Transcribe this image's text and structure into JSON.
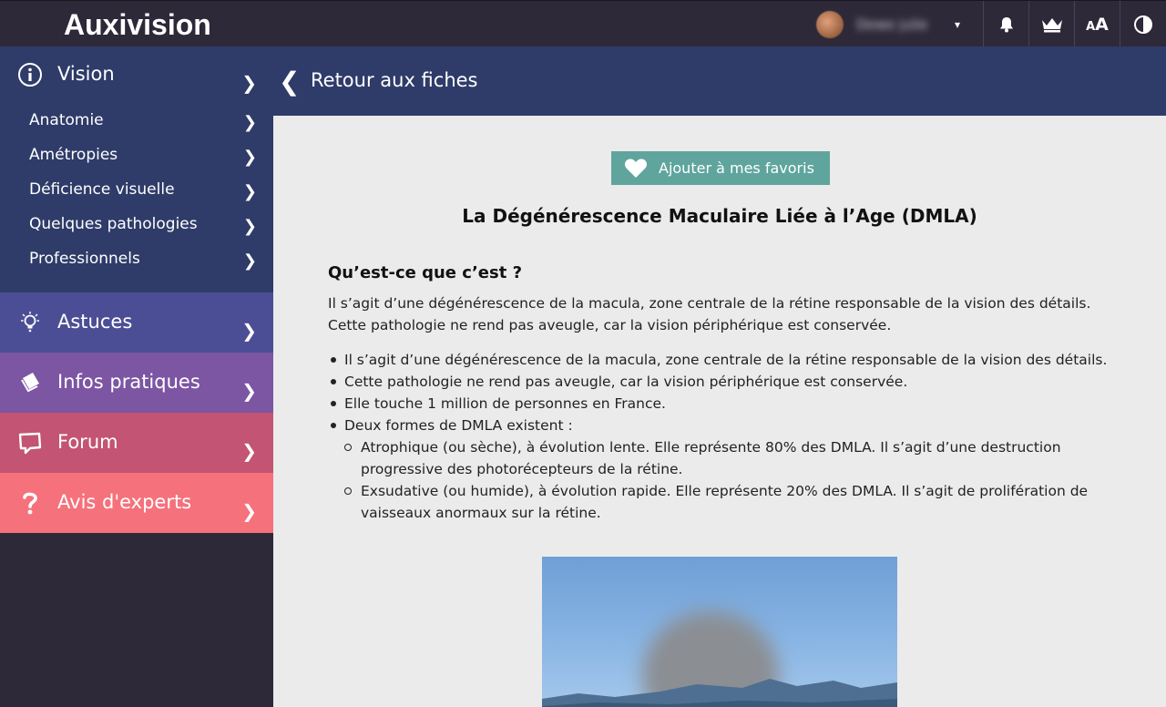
{
  "app": {
    "name": "Auxivision"
  },
  "header": {
    "user_name": "Dewe julie",
    "dropdown_caret": "▾",
    "icons": [
      "bell-icon",
      "crown-icon",
      "text-size-icon",
      "contrast-icon"
    ],
    "text_size_small": "A",
    "text_size_big": "A"
  },
  "sidebar": {
    "vision": {
      "label": "Vision",
      "icon": "info-icon",
      "items": [
        {
          "label": "Anatomie"
        },
        {
          "label": "Amétropies"
        },
        {
          "label": "Déficience visuelle"
        },
        {
          "label": "Quelques pathologies"
        },
        {
          "label": "Professionnels"
        }
      ]
    },
    "sections": [
      {
        "label": "Astuces",
        "icon": "lightbulb-icon",
        "color": "#4c4e95"
      },
      {
        "label": "Infos pratiques",
        "icon": "book-icon",
        "color": "#7c55a3"
      },
      {
        "label": "Forum",
        "icon": "chat-icon",
        "color": "#c35473"
      },
      {
        "label": "Avis d'experts",
        "icon": "question-icon",
        "color": "#f5717b"
      }
    ],
    "chevron": "❯"
  },
  "backbar": {
    "chevron": "❮",
    "label": "Retour aux fiches"
  },
  "content": {
    "favorite_label": "Ajouter à mes favoris",
    "title": "La Dégénérescence Maculaire Liée à l’Age (DMLA)",
    "subtitle": "Qu’est-ce que c’est ?",
    "intro": [
      "Il s’agit d’une dégénérescence de la macula, zone centrale de la rétine responsable de la vision des détails.",
      "Cette pathologie ne rend pas aveugle, car la vision périphérique est conservée."
    ],
    "bullets": [
      "Il s’agit d’une dégénérescence de la macula, zone centrale de la rétine responsable de la vision des détails.",
      "Cette pathologie ne rend pas aveugle, car la vision périphérique est conservée.",
      "Elle touche 1 million de personnes en France.",
      "Deux formes de DMLA existent :"
    ],
    "sub_bullets": [
      "Atrophique (ou sèche), à évolution lente. Elle représente 80% des DMLA. Il s’agit d’une destruction progressive des photorécepteurs de la rétine.",
      "Exsudative (ou humide), à évolution rapide. Elle représente 20% des DMLA. Il s’agit de prolifération de vaisseaux anormaux sur la rétine."
    ]
  },
  "colors": {
    "topbar": "#2e2938",
    "navy": "#2f3c69",
    "favorite_button": "#5fa59d",
    "content_bg": "#ebebeb"
  }
}
